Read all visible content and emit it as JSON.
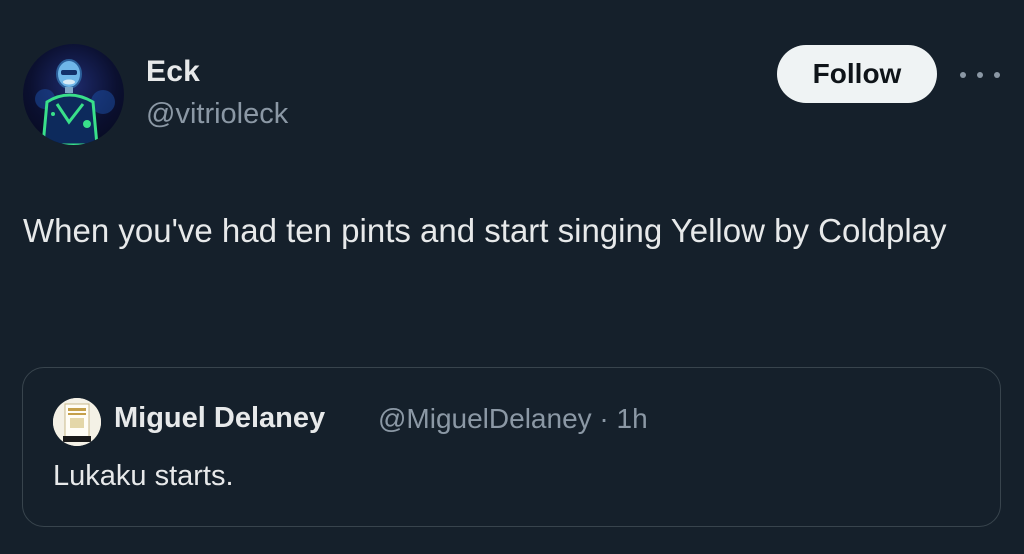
{
  "author": {
    "display_name": "Eck",
    "handle": "@vitrioleck",
    "avatar_icon": "robot-avatar-icon"
  },
  "actions": {
    "follow_label": "Follow",
    "more_icon": "more-horizontal-icon"
  },
  "tweet": {
    "text": "When you've had ten pints and start singing Yellow by Coldplay"
  },
  "quoted_tweet": {
    "display_name": "Miguel Delaney",
    "handle_time": "@MiguelDelaney · 1h",
    "text": "Lukaku starts.",
    "avatar_icon": "book-cover-avatar-icon"
  },
  "colors": {
    "background": "#15202b",
    "text_primary": "#e7e9ea",
    "text_secondary": "#8b98a5",
    "border": "#38444d",
    "follow_button_bg": "#eff3f4"
  }
}
